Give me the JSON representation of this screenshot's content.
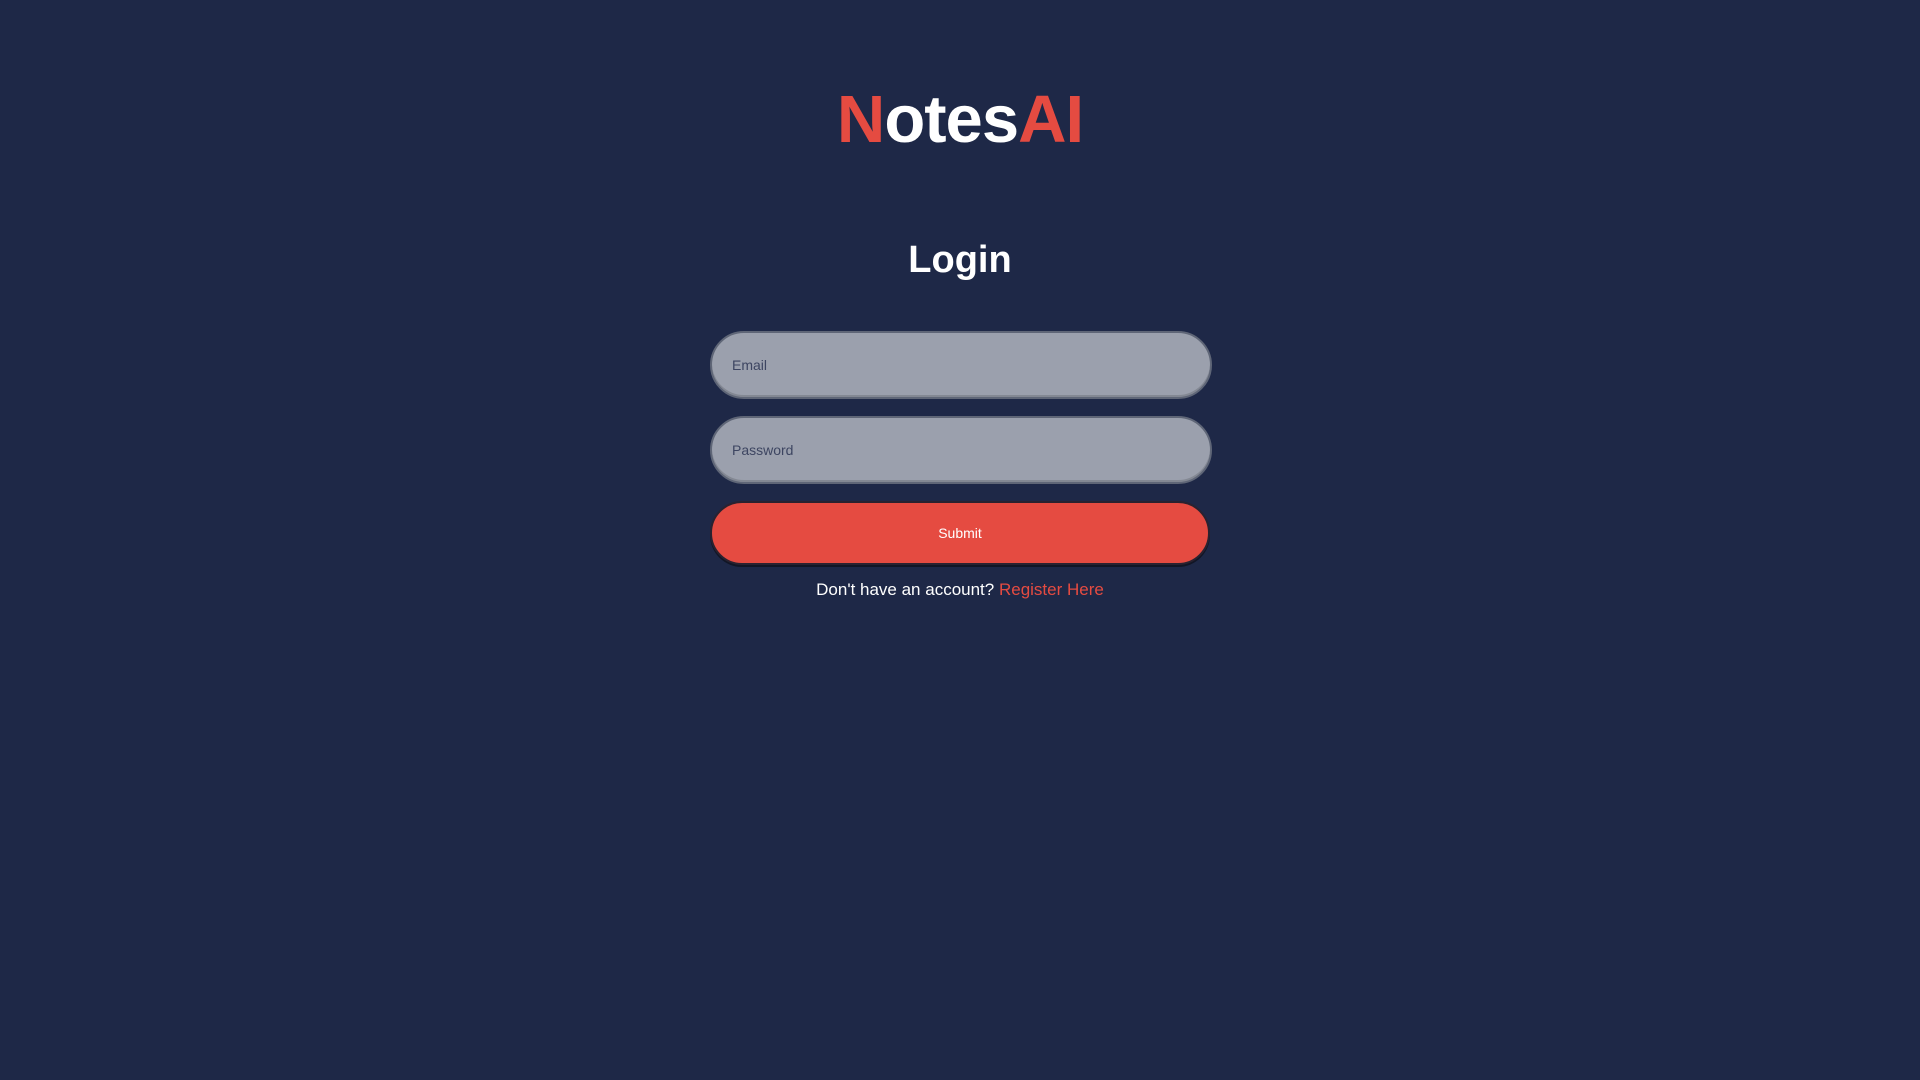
{
  "brand": {
    "letter_n": "N",
    "middle": "otes",
    "suffix": "AI"
  },
  "login": {
    "title": "Login",
    "email_placeholder": "Email",
    "email_value": "",
    "password_placeholder": "Password",
    "password_value": "",
    "submit_label": "Submit",
    "register_prompt": "Don't have an account?",
    "register_link": "Register Here"
  },
  "colors": {
    "background": "#1e2847",
    "accent": "#e54b41",
    "input_fill": "#9ba0ad",
    "text": "#ffffff"
  }
}
